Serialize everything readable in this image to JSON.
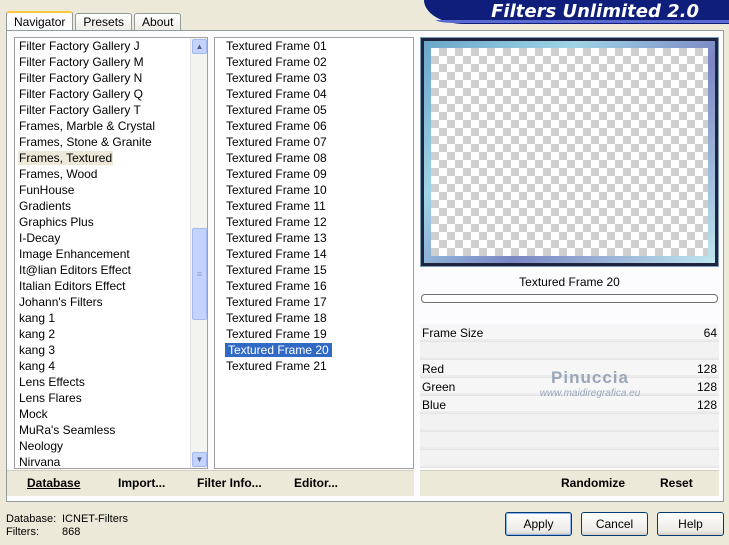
{
  "app_title": "Filters Unlimited 2.0",
  "tabs": [
    {
      "label": "Navigator"
    },
    {
      "label": "Presets"
    },
    {
      "label": "About"
    }
  ],
  "categories": [
    "Filter Factory Gallery J",
    "Filter Factory Gallery M",
    "Filter Factory Gallery N",
    "Filter Factory Gallery Q",
    "Filter Factory Gallery T",
    "Frames, Marble & Crystal",
    "Frames, Stone & Granite",
    "Frames, Textured",
    "Frames, Wood",
    "FunHouse",
    "Gradients",
    "Graphics Plus",
    "I-Decay",
    "Image Enhancement",
    "It@lian Editors Effect",
    "Italian Editors Effect",
    "Johann's Filters",
    "kang 1",
    "kang 2",
    "kang 3",
    "kang 4",
    "Lens Effects",
    "Lens Flares",
    "Mock",
    "MuRa's Seamless",
    "Neology",
    "Nirvana"
  ],
  "selected_category": "Frames, Textured",
  "filters": [
    "Textured Frame 01",
    "Textured Frame 02",
    "Textured Frame 03",
    "Textured Frame 04",
    "Textured Frame 05",
    "Textured Frame 06",
    "Textured Frame 07",
    "Textured Frame 08",
    "Textured Frame 09",
    "Textured Frame 10",
    "Textured Frame 11",
    "Textured Frame 12",
    "Textured Frame 13",
    "Textured Frame 14",
    "Textured Frame 15",
    "Textured Frame 16",
    "Textured Frame 17",
    "Textured Frame 18",
    "Textured Frame 19",
    "Textured Frame 20",
    "Textured Frame 21"
  ],
  "selected_filter": "Textured Frame 20",
  "preview": {
    "filter_name": "Textured Frame 20"
  },
  "sliders": [
    {
      "label": "Frame Size",
      "value": "64"
    },
    {
      "label": "",
      "value": ""
    },
    {
      "label": "Red",
      "value": "128"
    },
    {
      "label": "Green",
      "value": "128"
    },
    {
      "label": "Blue",
      "value": "128"
    },
    {
      "label": "",
      "value": ""
    },
    {
      "label": "",
      "value": ""
    },
    {
      "label": "",
      "value": ""
    }
  ],
  "watermark": {
    "line1": "Pinuccia",
    "line2": "www.maidiregrafica.eu"
  },
  "left_toolbar": {
    "database": "Database",
    "import": "Import...",
    "filter_info": "Filter Info...",
    "editor": "Editor..."
  },
  "right_toolbar": {
    "randomize": "Randomize",
    "reset": "Reset"
  },
  "status": {
    "database_label": "Database:",
    "database_value": "ICNET-Filters",
    "filters_label": "Filters:",
    "filters_value": "868"
  },
  "buttons": {
    "apply": "Apply",
    "cancel": "Cancel",
    "help": "Help"
  },
  "colors": {
    "banner": "#0f1e7a",
    "selection": "#316ac5",
    "window_bg": "#ece9d8"
  }
}
